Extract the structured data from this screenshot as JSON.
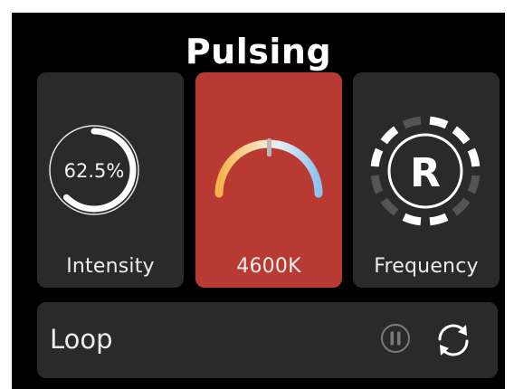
{
  "title": "Pulsing",
  "cards": {
    "intensity": {
      "value_text": "62.5%",
      "value_fraction": 0.625,
      "label": "Intensity",
      "icon": "intensity-ring-icon"
    },
    "temperature": {
      "label": "4600K",
      "icon": "color-temperature-gauge-icon",
      "accent": "#b83a33"
    },
    "frequency": {
      "mode_letter": "R",
      "label": "Frequency",
      "icon": "frequency-dial-icon"
    }
  },
  "loop": {
    "label": "Loop",
    "pause_icon": "pause-icon",
    "repeat_icon": "repeat-icon"
  },
  "colors": {
    "background": "#000000",
    "card": "#2a2a2a",
    "active_card": "#b83a33",
    "text": "#ececec"
  }
}
